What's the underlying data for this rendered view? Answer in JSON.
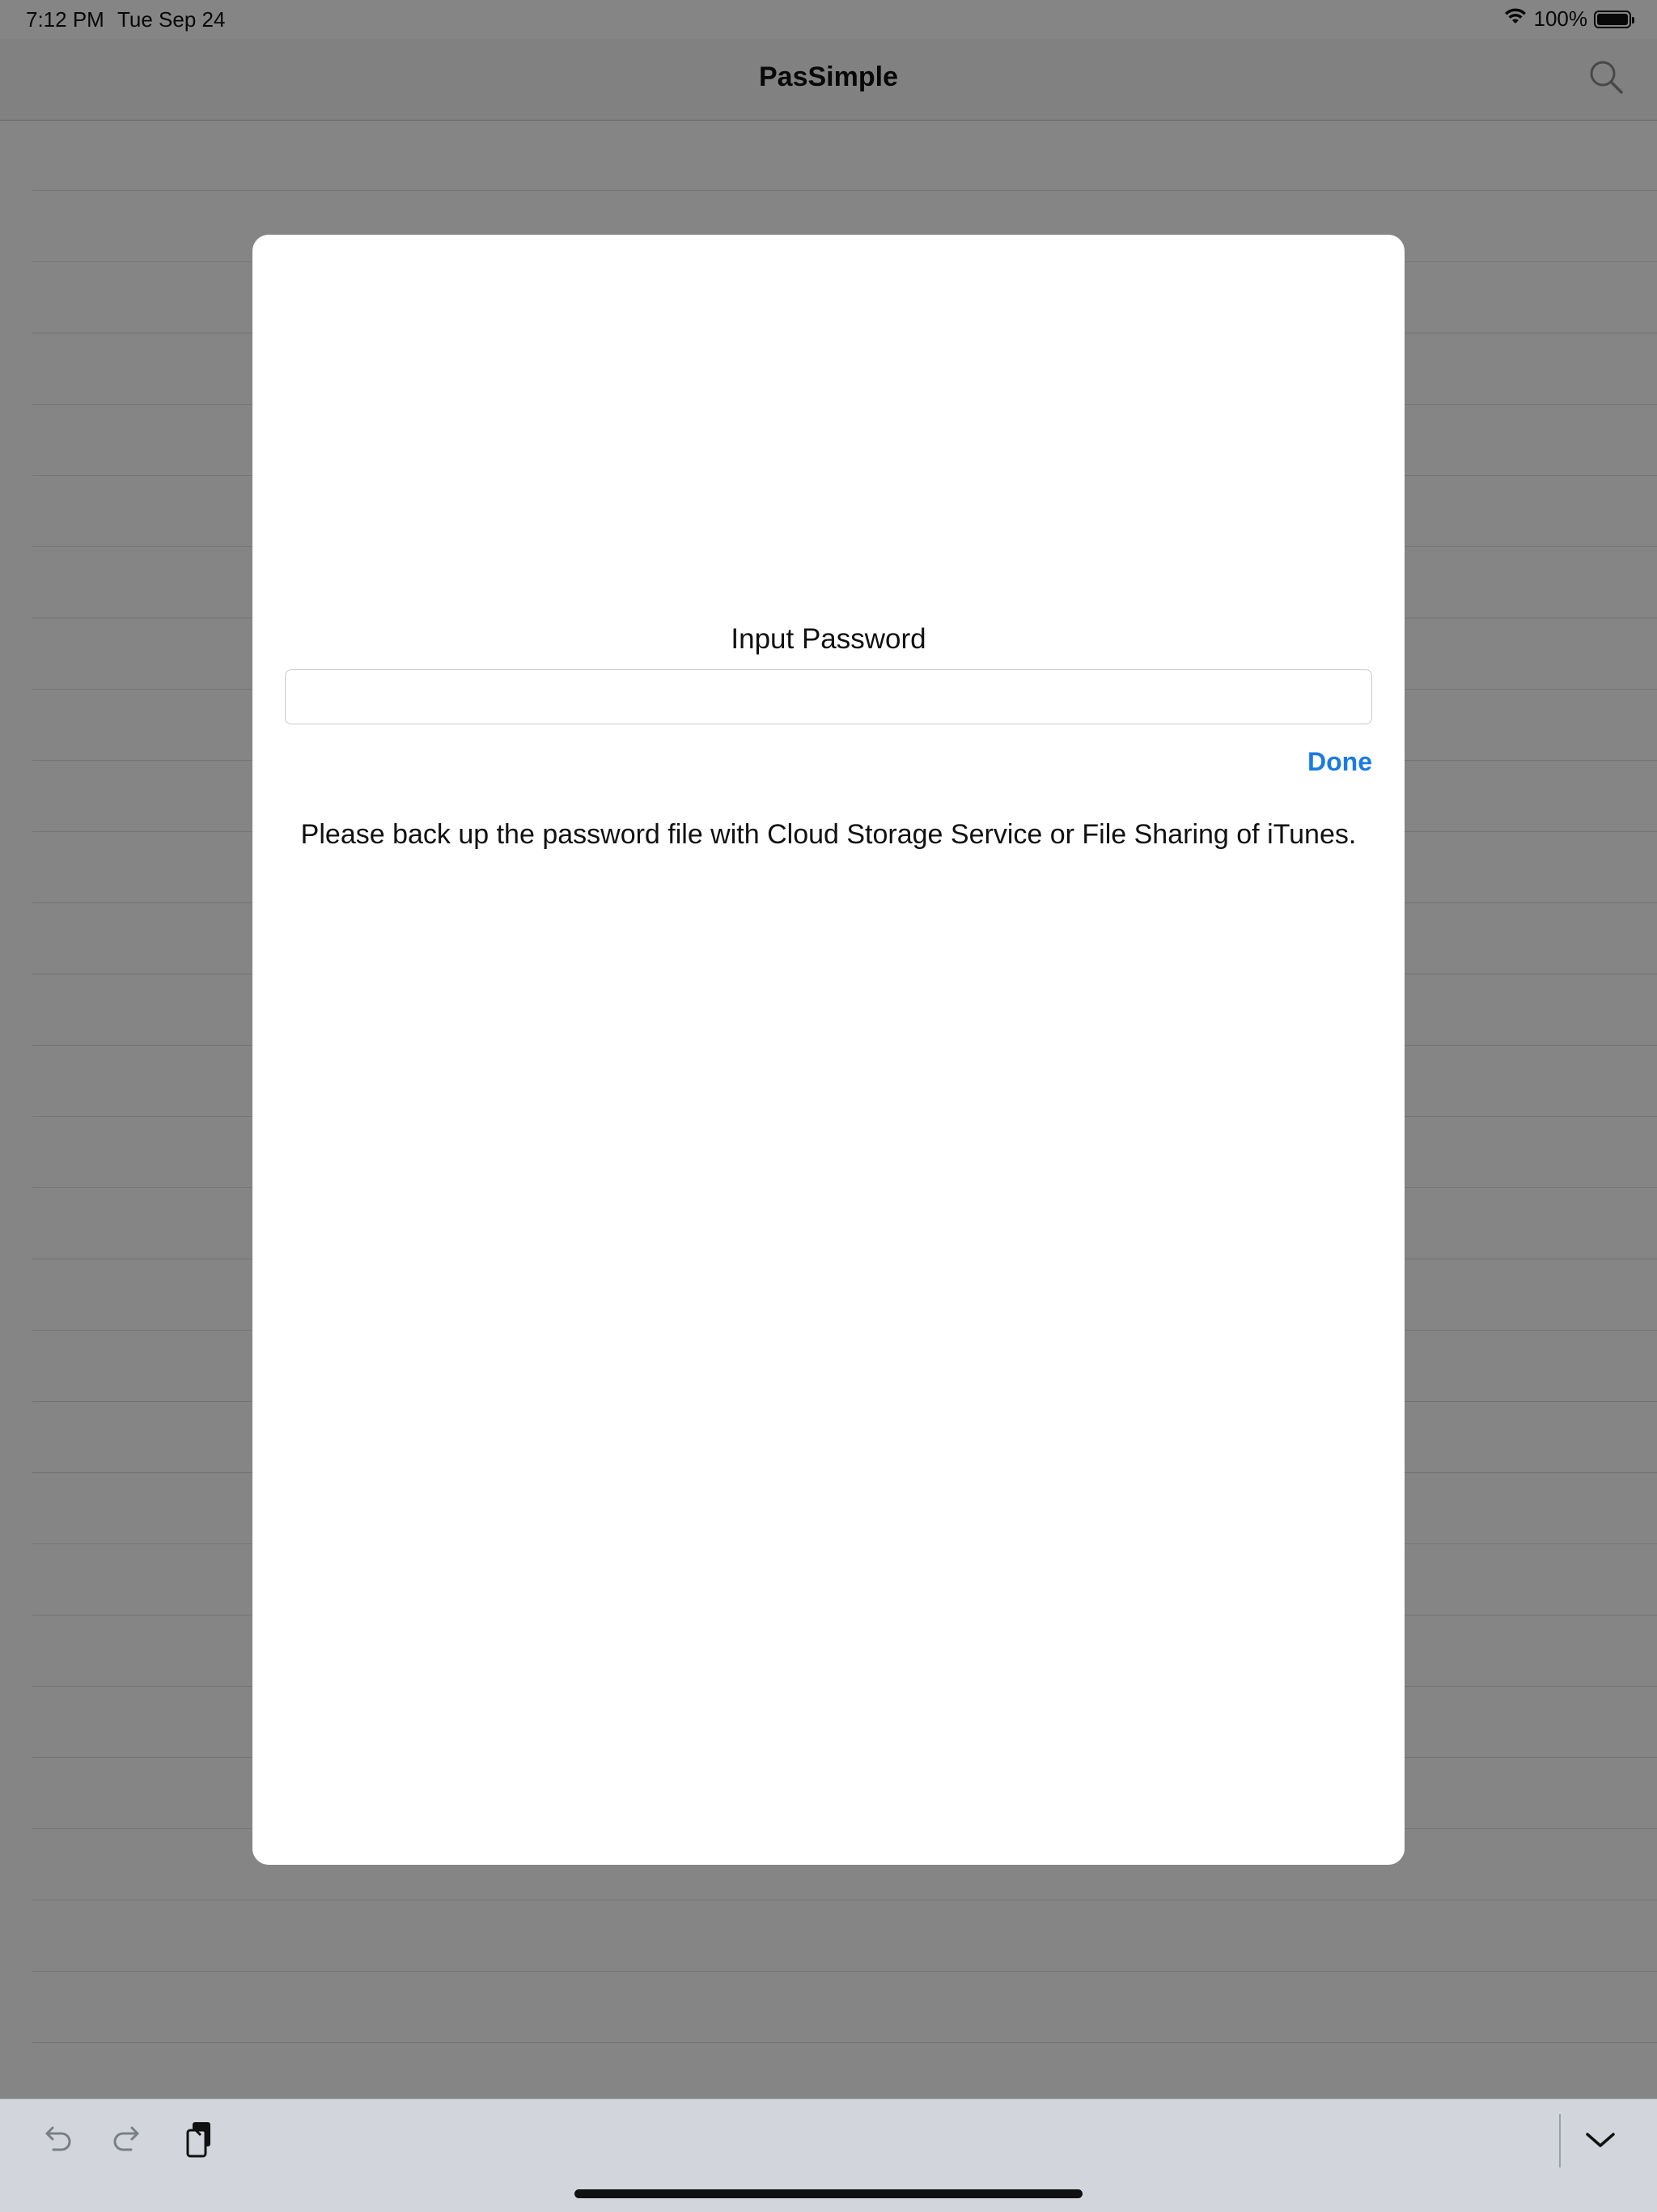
{
  "status_bar": {
    "time": "7:12 PM",
    "date": "Tue Sep 24",
    "battery": "100%",
    "wifi_icon": "wifi-icon",
    "battery_icon": "battery-icon"
  },
  "nav": {
    "title": "PasSimple",
    "search_icon": "search-icon"
  },
  "sheet": {
    "label": "Input Password",
    "input_value": "",
    "input_placeholder": "",
    "done_label": "Done",
    "notice": "Please back up the password file with Cloud Storage Service or File Sharing of iTunes."
  },
  "toolbar": {
    "undo_icon": "undo-icon",
    "redo_icon": "redo-icon",
    "paste_icon": "paste-icon",
    "dismiss_icon": "chevron-down-icon"
  },
  "colors": {
    "accent": "#1a7ae6",
    "overlay": "rgba(0,0,0,0.48)"
  }
}
